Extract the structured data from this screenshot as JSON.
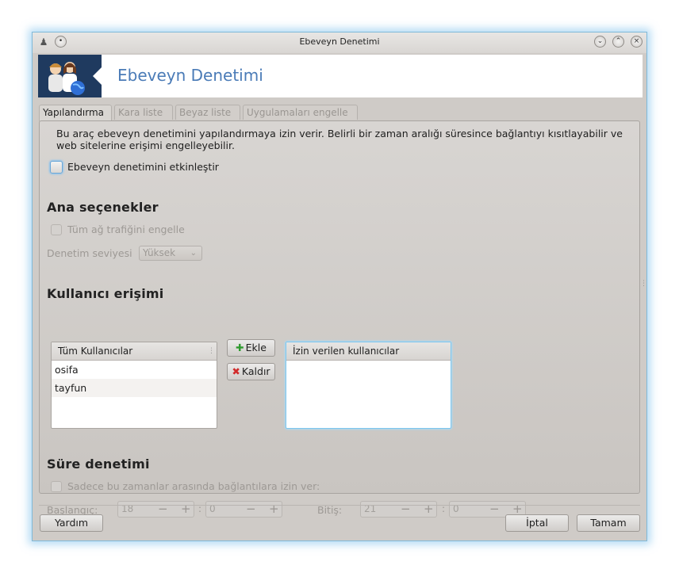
{
  "window": {
    "title": "Ebeveyn Denetimi"
  },
  "header": {
    "title": "Ebeveyn Denetimi"
  },
  "tabs": [
    {
      "label": "Yapılandırma",
      "active": true
    },
    {
      "label": "Kara liste",
      "active": false
    },
    {
      "label": "Beyaz liste",
      "active": false
    },
    {
      "label": "Uygulamaları engelle",
      "active": false
    }
  ],
  "config": {
    "description": "Bu araç ebeveyn denetimini yapılandırmaya izin verir. Belirli bir zaman aralığı süresince bağlantıyı kısıtlayabilir ve web sitelerine erişimi engelleyebilir.",
    "enable_label": "Ebeveyn denetimini etkinleştir",
    "enable_checked": false
  },
  "main_options": {
    "title": "Ana seçenekler",
    "block_all_label": "Tüm ağ trafiğini engelle",
    "level_label": "Denetim seviyesi",
    "level_value": "Yüksek"
  },
  "user_access": {
    "title": "Kullanıcı erişimi",
    "all_users_header": "Tüm Kullanıcılar",
    "all_users": [
      "osifa",
      "tayfun"
    ],
    "add_label": "Ekle",
    "remove_label": "Kaldır",
    "allowed_header": "İzin verilen kullanıcılar",
    "allowed_users": []
  },
  "time_control": {
    "title": "Süre denetimi",
    "only_between_label": "Sadece bu zamanlar arasında bağlantılara izin ver:",
    "start_label": "Başlangıç:",
    "start_hour": "18",
    "start_minute": "0",
    "end_label": "Bitiş:",
    "end_hour": "21",
    "end_minute": "0",
    "separator": ":"
  },
  "buttons": {
    "help": "Yardım",
    "cancel": "İptal",
    "ok": "Tamam"
  },
  "colors": {
    "accent_title": "#4a7bb7",
    "focus_border": "#7dc6ee",
    "logo_bg": "#1f3a5f"
  }
}
